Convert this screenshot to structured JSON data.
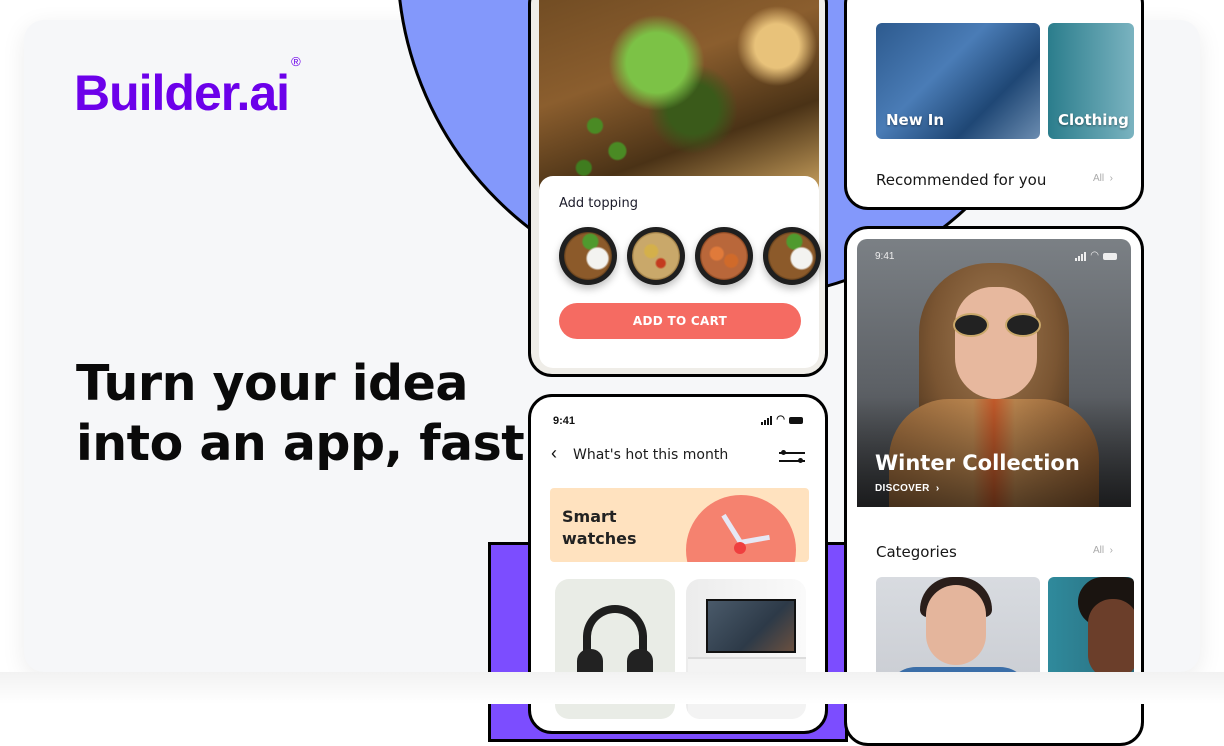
{
  "brand": {
    "logo_text": "Builder.ai",
    "registered_mark": "®",
    "color": "#6c00ea"
  },
  "hero": {
    "headline_line1": "Turn your idea",
    "headline_line2": "into an app, fast"
  },
  "food_app": {
    "topping_title": "Add topping",
    "toppings": [
      {
        "name": "topping-rice-stirfry"
      },
      {
        "name": "topping-fried-rice"
      },
      {
        "name": "topping-shrimp-noodles"
      },
      {
        "name": "topping-rice-stirfry-2"
      }
    ],
    "add_to_cart_label": "ADD TO CART",
    "button_color": "#f56b62"
  },
  "hot_app": {
    "status_time": "9:41",
    "title": "What's hot this month",
    "back_icon": "chevron-left-icon",
    "filter_icon": "sliders-icon",
    "banner_title": "Smart watches",
    "banner_color": "#ffe2bf",
    "products": [
      "headphones",
      "tv"
    ]
  },
  "fashion_app": {
    "tiles": [
      {
        "label": "New In"
      },
      {
        "label": "Clothing"
      }
    ],
    "recommended_title": "Recommended for you",
    "all_label": "All",
    "chevron": "›"
  },
  "winter_app": {
    "status_time": "9:41",
    "hero_title": "Winter Collection",
    "discover_label": "DISCOVER",
    "discover_chevron": "›",
    "categories_title": "Categories",
    "all_label": "All",
    "chevron": "›"
  },
  "decor": {
    "circle_color": "#8398fb",
    "rect_color": "#7c4dff"
  }
}
